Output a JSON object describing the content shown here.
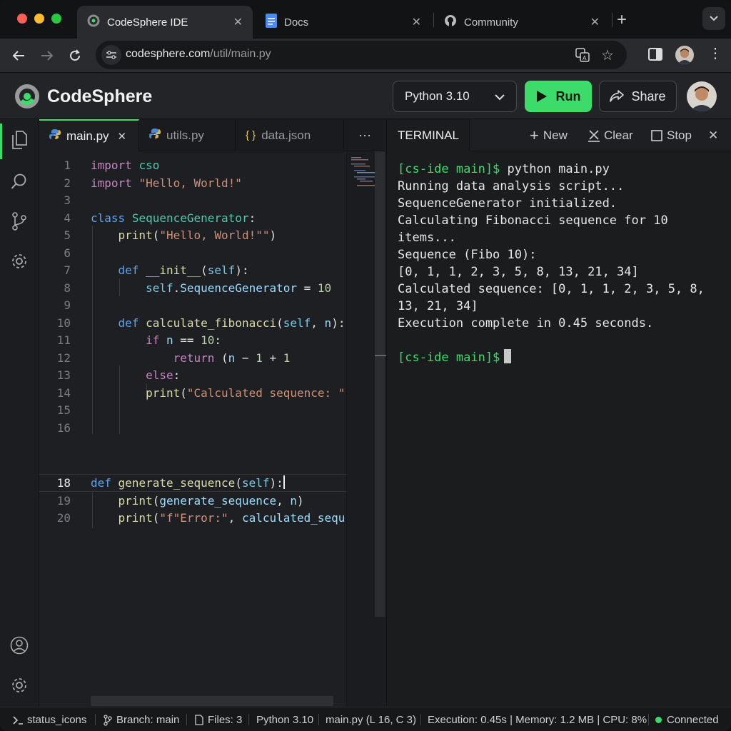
{
  "browser": {
    "tabs": [
      {
        "label": "CodeSphere IDE",
        "icon": "codesphere-logo-icon",
        "active": true
      },
      {
        "label": "Docs",
        "icon": "document-icon",
        "active": false
      },
      {
        "label": "Community",
        "icon": "github-icon",
        "active": false
      }
    ],
    "url_host": "codesphere.com",
    "url_path": "/util/main.py"
  },
  "app": {
    "name": "CodeSphere",
    "language": "Python 3.10",
    "run_label": "Run",
    "share_label": "Share"
  },
  "editor": {
    "tabs": [
      {
        "label": "main.py",
        "icon": "python-icon",
        "active": true
      },
      {
        "label": "utils.py",
        "icon": "python-icon",
        "active": false
      },
      {
        "label": "data.json",
        "icon": "json-braces-icon",
        "active": false
      }
    ],
    "more_label": "···",
    "current_line": "16",
    "line_numbers": [
      "1",
      "2",
      "3",
      "4",
      "5",
      "6",
      "7",
      "8",
      "9",
      "10",
      "11",
      "12",
      "13",
      "14",
      "15",
      "16",
      "18",
      "19",
      "20"
    ]
  },
  "terminal": {
    "title": "TERMINAL",
    "actions": {
      "new": "New",
      "clear": "Clear",
      "stop": "Stop"
    },
    "prompt1": "[cs-ide main]$",
    "command1": " python main.py",
    "lines": [
      "Running data analysis script...",
      "SequenceGenerator initialized.",
      "Calculating Fibonacci sequence for 10",
      "items...",
      "Sequence (Fibo 10):",
      "[0, 1, 1, 2, 3, 5, 8, 13, 21, 34]",
      "Calculated sequence: [0, 1, 1, 2, 3, 5, 8,",
      "13, 21, 34]",
      "Execution complete in 0.45 seconds."
    ],
    "prompt2": "[cs-ide main]$"
  },
  "statusbar": {
    "status_icons": "status_icons",
    "branch": "Branch: main",
    "files": "Files: 3",
    "language": "Python 3.10",
    "position": "main.py (L 16, C 3)",
    "metrics": "Execution: 0.45s | Memory: 1.2 MB | CPU: 8%",
    "connection": "Connected"
  },
  "colors": {
    "accent_green": "#3ddc6a",
    "background": "#1e1f22"
  }
}
